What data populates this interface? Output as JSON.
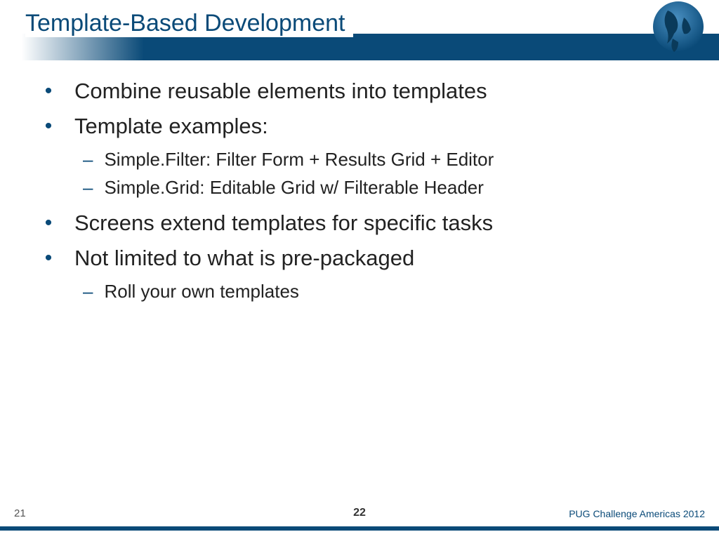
{
  "title": "Template-Based Development",
  "bullets": [
    {
      "level": 1,
      "text": "Combine reusable elements into templates"
    },
    {
      "level": 1,
      "text": "Template examples:"
    },
    {
      "level": 2,
      "text": "Simple.Filter: Filter Form + Results Grid + Editor"
    },
    {
      "level": 2,
      "text": "Simple.Grid: Editable Grid w/ Filterable Header"
    },
    {
      "level": 1,
      "text": "Screens extend templates for specific tasks"
    },
    {
      "level": 1,
      "text": "Not limited to what is pre-packaged"
    },
    {
      "level": 2,
      "text": "Roll your own templates"
    }
  ],
  "footer": {
    "left": "21",
    "center": "22",
    "right": "PUG Challenge Americas 2012"
  }
}
